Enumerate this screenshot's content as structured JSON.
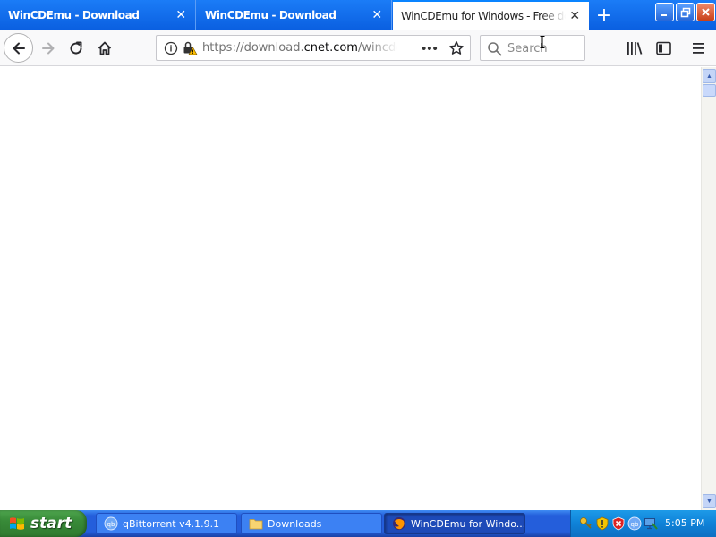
{
  "tabs": [
    {
      "label": "WinCDEmu - Download",
      "active": false
    },
    {
      "label": "WinCDEmu - Download",
      "active": false
    },
    {
      "label": "WinCDEmu for Windows - Free download",
      "active": true
    }
  ],
  "navbar": {
    "url_prefix": "https://download.",
    "url_domain": "cnet.com",
    "url_path": "/wincdemu/",
    "search_placeholder": "Search"
  },
  "taskbar": {
    "start_label": "start",
    "tasks": [
      {
        "label": "qBittorrent v4.1.9.1",
        "icon": "qbittorrent-icon"
      },
      {
        "label": "Downloads",
        "icon": "folder-icon"
      },
      {
        "label": "WinCDEmu for Windo...",
        "icon": "firefox-icon"
      }
    ],
    "clock": "5:05 PM"
  },
  "colors": {
    "tab_strip": "#1b7cf7",
    "taskbar": "#245edb",
    "start_button": "#388a38",
    "tray": "#0f82d8"
  }
}
